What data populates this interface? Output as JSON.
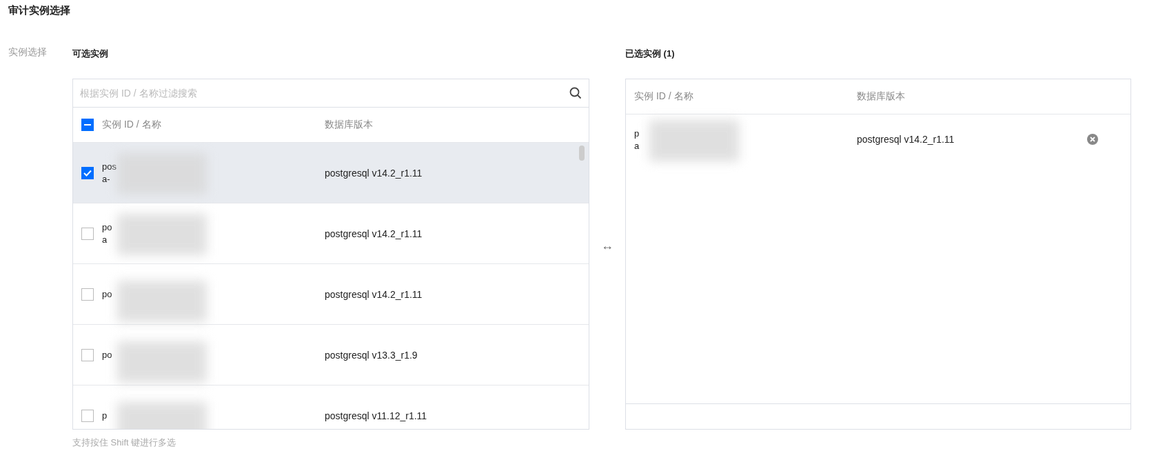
{
  "page_title": "审计实例选择",
  "field_label": "实例选择",
  "available": {
    "title": "可选实例",
    "search": {
      "placeholder": "根据实例 ID / 名称过滤搜索"
    },
    "select_all": {
      "checked": true,
      "indeterminate": true
    },
    "columns": [
      "实例 ID / 名称",
      "数据库版本"
    ],
    "rows": [
      {
        "id_lines": [
          "pos",
          "a-"
        ],
        "version": "postgresql v14.2_r1.11",
        "checked": true
      },
      {
        "id_lines": [
          "po",
          "a"
        ],
        "version": "postgresql v14.2_r1.11",
        "checked": false
      },
      {
        "id_lines": [
          "po"
        ],
        "version": "postgresql v14.2_r1.11",
        "checked": false
      },
      {
        "id_lines": [
          "po"
        ],
        "version": "postgresql v13.3_r1.9",
        "checked": false
      },
      {
        "id_lines": [
          "p"
        ],
        "version": "postgresql v11.12_r1.11",
        "checked": false
      }
    ],
    "hint": "支持按住 Shift 键进行多选"
  },
  "swap_icon": "↔",
  "selected": {
    "title": "已选实例 (1)",
    "columns": [
      "实例 ID / 名称",
      "数据库版本"
    ],
    "rows": [
      {
        "id_lines": [
          "p",
          "a"
        ],
        "version": "postgresql v14.2_r1.11"
      }
    ]
  }
}
